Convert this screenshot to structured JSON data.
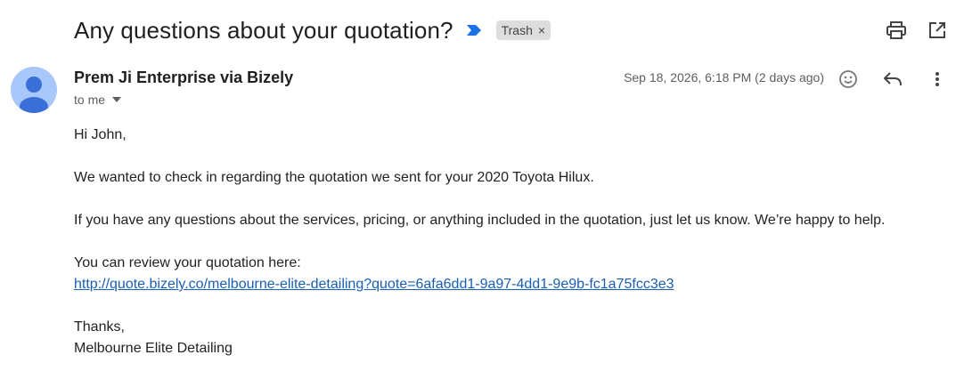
{
  "subject": "Any questions about your quotation?",
  "label": {
    "name": "Trash",
    "remove_glyph": "×"
  },
  "toolbar": {
    "print_icon": "print-icon",
    "open_new_window_icon": "open-in-new-window-icon"
  },
  "message": {
    "sender": "Prem Ji Enterprise via Bizely",
    "recipient": "to me",
    "date": "Sep 18, 2026, 6:18 PM (2 days ago)",
    "icons": [
      "emoji-reaction-icon",
      "reply-icon",
      "more-vert-icon"
    ]
  },
  "body": {
    "greeting": "Hi John,",
    "para1": "We wanted to check in regarding the quotation we sent for your 2020 Toyota Hilux.",
    "para2": "If you have any questions about the services, pricing, or anything included in the quotation, just let us know. We’re happy to help.",
    "review_intro": "You can review your quotation here:",
    "link": "http://quote.bizely.co/melbourne-elite-detailing?quote=6afa6dd1-9a97-4dd1-9e9b-fc1a75fcc3e3",
    "signoff": "Thanks,",
    "signature": "Melbourne Elite Detailing"
  },
  "colors": {
    "importance_marker": "#1a73e8",
    "avatar_bg": "#a8c7fa",
    "avatar_fg": "#3b6fd8",
    "link": "#1a5fb4",
    "chip_bg": "#dddddd"
  }
}
